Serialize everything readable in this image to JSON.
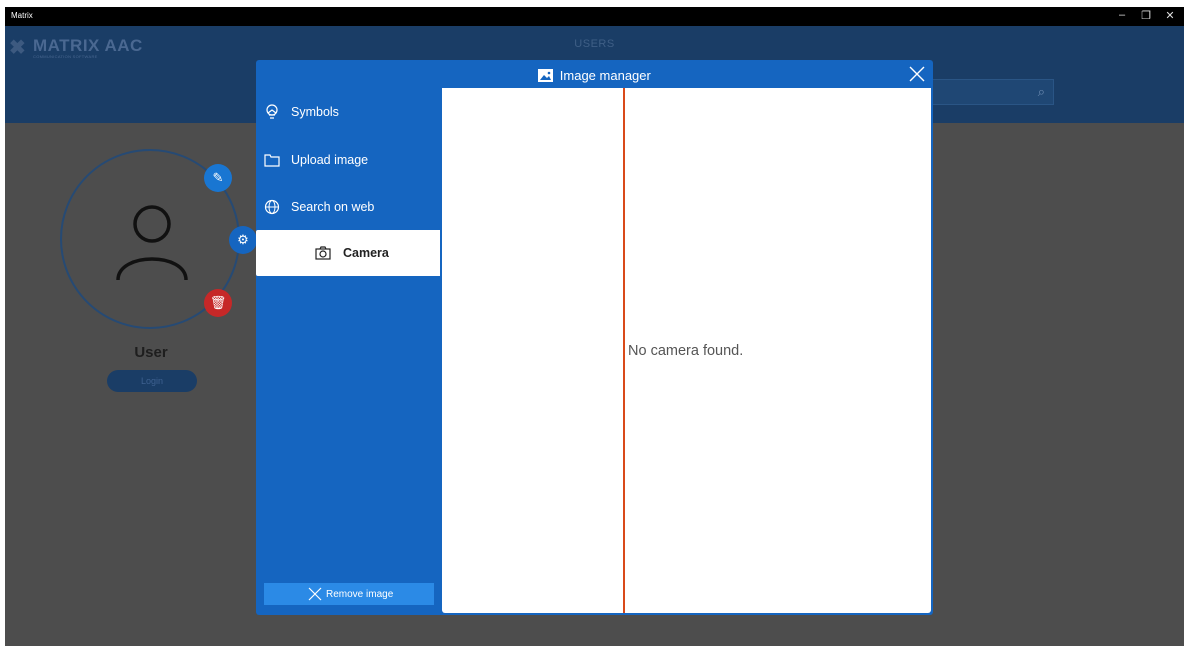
{
  "window": {
    "title": "Matrix",
    "controls": [
      "–",
      "❐",
      "✕"
    ]
  },
  "header": {
    "logo_name": "MATRIX AAC",
    "logo_sub": "COMMUNICATION SOFTWARE",
    "page_title": "USERS",
    "search_icon": "search-icon"
  },
  "user": {
    "name": "User",
    "login_label": "Login"
  },
  "modal": {
    "title": "Image manager",
    "nav": [
      {
        "label": "Symbols",
        "icon": "lightbulb-icon",
        "active": false
      },
      {
        "label": "Upload image",
        "icon": "folder-icon",
        "active": false
      },
      {
        "label": "Search on web",
        "icon": "globe-icon",
        "active": false
      },
      {
        "label": "Camera",
        "icon": "camera-icon",
        "active": true
      }
    ],
    "remove_label": "Remove image",
    "message": "No camera found."
  },
  "colors": {
    "header": "#1a3d66",
    "modal": "#1565c0",
    "accent_line": "#d94a1a",
    "edit_badge": "#1976d2",
    "delete_badge": "#c62828"
  }
}
